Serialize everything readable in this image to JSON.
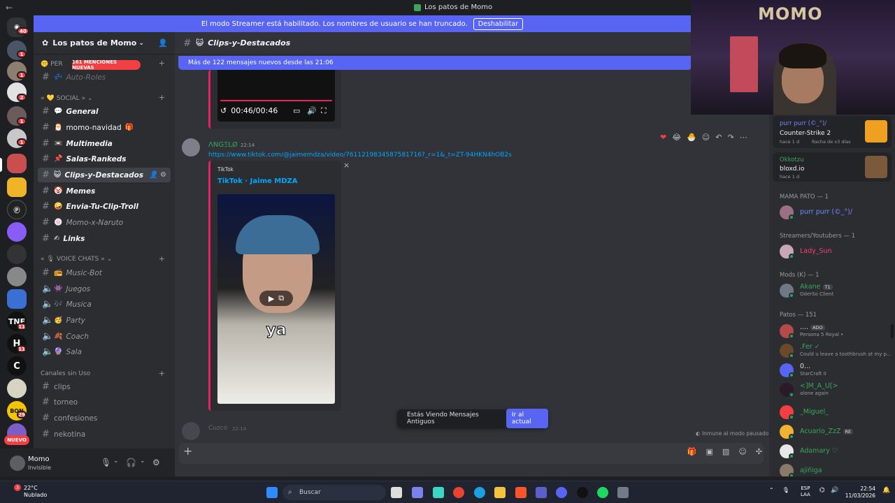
{
  "titlebar": {
    "back": "←",
    "title": "Los patos de Momo"
  },
  "streamer": {
    "message": "El modo Streamer está habilitado. Los nombres de usuario se han truncado.",
    "button": "Deshabilitar"
  },
  "servers": {
    "dm_badge": "40",
    "new_label": "NUEVO",
    "badges": [
      "1",
      "1",
      "1",
      "2",
      "1",
      "1",
      "11",
      "11",
      "29"
    ]
  },
  "guild": {
    "name": "Los patos de Momo",
    "mentions": "161 MENCIONES NUEVAS"
  },
  "categories": {
    "per": "PER",
    "social": "SOCIAL",
    "voice": "VOICE CHATS",
    "unused": "Canales sin Uso"
  },
  "channels": [
    {
      "name": "Auto-Roles",
      "emoji": "💤"
    },
    {
      "name": "General",
      "emoji": "💬"
    },
    {
      "name": "momo-navidad",
      "emoji": "🎅",
      "suffix": "🎁"
    },
    {
      "name": "Multimedia",
      "emoji": "📼"
    },
    {
      "name": "Salas-Rankeds",
      "emoji": "📌"
    },
    {
      "name": "Clips-y-Destacados",
      "emoji": "😺"
    },
    {
      "name": "Memes",
      "emoji": "🤡"
    },
    {
      "name": "Envia-Tu-Clip-Troll",
      "emoji": "🤪"
    },
    {
      "name": "Momo-x-Naruto",
      "emoji": "🍥"
    },
    {
      "name": "Links",
      "emoji": "✍"
    }
  ],
  "voice_channels": [
    {
      "name": "Music-Bot",
      "emoji": "📻"
    },
    {
      "name": "Juegos",
      "emoji": "👾"
    },
    {
      "name": "Musica",
      "emoji": "🎶"
    },
    {
      "name": "Party",
      "emoji": "🥳"
    },
    {
      "name": "Coach",
      "emoji": "🍂"
    },
    {
      "name": "Sala",
      "emoji": "🔮"
    }
  ],
  "unused_channels": [
    "clips",
    "torneo",
    "confesiones",
    "nekotina"
  ],
  "user": {
    "name": "Momo",
    "status": "Invisible"
  },
  "channel_header": {
    "name": "Clips-y-Destacados",
    "emoji": "😺"
  },
  "new_messages": "Más de 122 mensajes nuevos desde las 21:06",
  "video": {
    "time": "00:46/00:46"
  },
  "message": {
    "author": "ΛNGΞLØ",
    "time": "22:14",
    "link": "https://www.tiktok.com/@jaimemdza/video/7611219834587581716?_r=1&_t=ZT-94HKN4hOB2s",
    "embed_provider": "TikTok",
    "embed_title": "TikTok · Jaime MDZA",
    "caption": "ya"
  },
  "next_message": {
    "author": "Cuzco",
    "time": "22:14"
  },
  "toast": {
    "text": "Estás Viendo Mensajes Antiguos",
    "button": "Ir al actual"
  },
  "immune": "Inmune al modo pausado",
  "activities": [
    {
      "name": "purr purr (©_°)/",
      "game": "Counter-Strike 2",
      "meta": "hace 1 d",
      "extra": "Racha de x3 días"
    },
    {
      "name": "Okkotzu",
      "game": "bloxd.io",
      "meta": "hace 1 d"
    }
  ],
  "member_groups": [
    {
      "title": "MAMA PATO — 1"
    },
    {
      "title": "Streamers/Youtubers — 1"
    },
    {
      "title": "Mods (K) — 1"
    },
    {
      "title": "Patos — 151"
    }
  ],
  "members": [
    {
      "name": "purr purr (©_°)/",
      "color": "#7289ff",
      "sub": ""
    },
    {
      "name": "Lady_Sun",
      "color": "#f23f72",
      "sub": ""
    },
    {
      "name": "Akane",
      "color": "#3ba55c",
      "sub": "OderSo Client",
      "tag": "T1"
    },
    {
      "name": "....",
      "color": "#dbdee1",
      "sub": "Persona 5 Royal •",
      "tag": "ADO"
    },
    {
      "name": ".Fer ✓",
      "color": "#3ba55c",
      "sub": "Could u leave a toothbrush at my p..."
    },
    {
      "name": "0...",
      "color": "#dbdee1",
      "sub": "StarCraft II"
    },
    {
      "name": "<]M_A_U[>",
      "color": "#3ba55c",
      "sub": "alone again"
    },
    {
      "name": "_Miguel_",
      "color": "#3ba55c",
      "sub": ""
    },
    {
      "name": "Acuario_ZzZ",
      "color": "#3ba55c",
      "sub": "",
      "tag": "RE"
    },
    {
      "name": "Adamary ♡",
      "color": "#3ba55c",
      "sub": ""
    },
    {
      "name": "ajiñiga",
      "color": "#3ba55c",
      "sub": ""
    }
  ],
  "stream": {
    "overlay_text": "MOMO"
  },
  "taskbar": {
    "weather_temp": "22°C",
    "weather_desc": "Nublado",
    "weather_badge": "3",
    "search": "Buscar",
    "lang": "ESP",
    "lang2": "LAA",
    "time": "22:54",
    "date": "11/03/2026"
  }
}
